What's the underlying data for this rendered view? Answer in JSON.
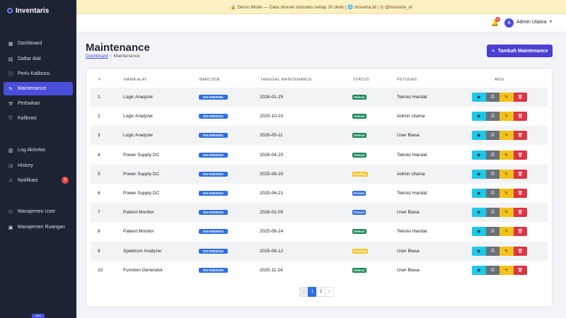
{
  "app": {
    "name": "Inventaris"
  },
  "banner": {
    "text": "🔒 Demo Mode — Data direset otomatis setiap 30 detik | 🌐 inovarta.id | ◎ @inovarta_id"
  },
  "sidebar": {
    "items": [
      {
        "label": "Dashboard",
        "icon": "grid-icon"
      },
      {
        "label": "Daftar Alat",
        "icon": "list-icon"
      },
      {
        "label": "Perlu Kalibrasi",
        "icon": "alert-icon"
      },
      {
        "label": "Maintenance",
        "icon": "wrench-icon",
        "active": true
      },
      {
        "label": "Perbaikan",
        "icon": "tool-icon"
      },
      {
        "label": "Kalibrasi",
        "icon": "shield-icon"
      },
      {
        "label": "Log Aktivitas",
        "icon": "log-icon"
      },
      {
        "label": "History",
        "icon": "clock-icon"
      },
      {
        "label": "Notifikasi",
        "icon": "bell-icon",
        "badge": "9"
      },
      {
        "label": "Manajemen User",
        "icon": "users-icon"
      },
      {
        "label": "Manajemen Ruangan",
        "icon": "room-icon"
      }
    ],
    "bottom_tag": "Mini"
  },
  "topbar": {
    "notif_count": "9",
    "avatar_letter": "A",
    "user_name": "Admin Utama"
  },
  "page": {
    "title": "Maintenance",
    "breadcrumb_home": "Dashboard",
    "breadcrumb_current": "Maintenance",
    "add_button": "Tambah Maintenance"
  },
  "table": {
    "headers": {
      "no": "#",
      "name": "NAMA ALAT",
      "barcode": "BARCODE",
      "date": "TANGGAL MAINTENANCE",
      "status": "STATUS",
      "officer": "PETUGAS",
      "actions": "AKSI"
    },
    "rows": [
      {
        "no": "1",
        "name": "Logic Analyzer",
        "barcode": "INV-00000001",
        "date": "2026-01-25",
        "status": "Selesai",
        "officer": "Teknisi Handal"
      },
      {
        "no": "2",
        "name": "Logic Analyzer",
        "barcode": "INV-00000001",
        "date": "2025-10-10",
        "status": "Selesai",
        "officer": "Admin Utama"
      },
      {
        "no": "3",
        "name": "Logic Analyzer",
        "barcode": "INV-00000001",
        "date": "2026-05-11",
        "status": "Selesai",
        "officer": "User Biasa"
      },
      {
        "no": "4",
        "name": "Power Supply DC",
        "barcode": "INV-00000002",
        "date": "2026-04-20",
        "status": "Selesai",
        "officer": "Teknisi Handal"
      },
      {
        "no": "5",
        "name": "Power Supply DC",
        "barcode": "INV-00000002",
        "date": "2025-08-20",
        "status": "Pending",
        "officer": "Admin Utama"
      },
      {
        "no": "6",
        "name": "Power Supply DC",
        "barcode": "INV-00000002",
        "date": "2025-06-21",
        "status": "Proses",
        "officer": "Teknisi Handal"
      },
      {
        "no": "7",
        "name": "Patient Monitor",
        "barcode": "INV-00000003",
        "date": "2026-02-05",
        "status": "Proses",
        "officer": "User Biasa"
      },
      {
        "no": "8",
        "name": "Patient Monitor",
        "barcode": "INV-00000003",
        "date": "2025-06-24",
        "status": "Selesai",
        "officer": "Teknisi Handal"
      },
      {
        "no": "9",
        "name": "Spektrum Analyzer",
        "barcode": "INV-00000004",
        "date": "2025-08-12",
        "status": "Pending",
        "officer": "User Biasa"
      },
      {
        "no": "10",
        "name": "Function Generator",
        "barcode": "INV-00000005",
        "date": "2025-11-24",
        "status": "Selesai",
        "officer": "User Biasa"
      }
    ],
    "status_colors": {
      "Selesai": "#198754",
      "Pending": "#f5c227",
      "Proses": "#2f6fe0"
    }
  },
  "pagination": {
    "prev": "‹",
    "pages": [
      "1",
      "2"
    ],
    "next": "›",
    "current": "1"
  }
}
